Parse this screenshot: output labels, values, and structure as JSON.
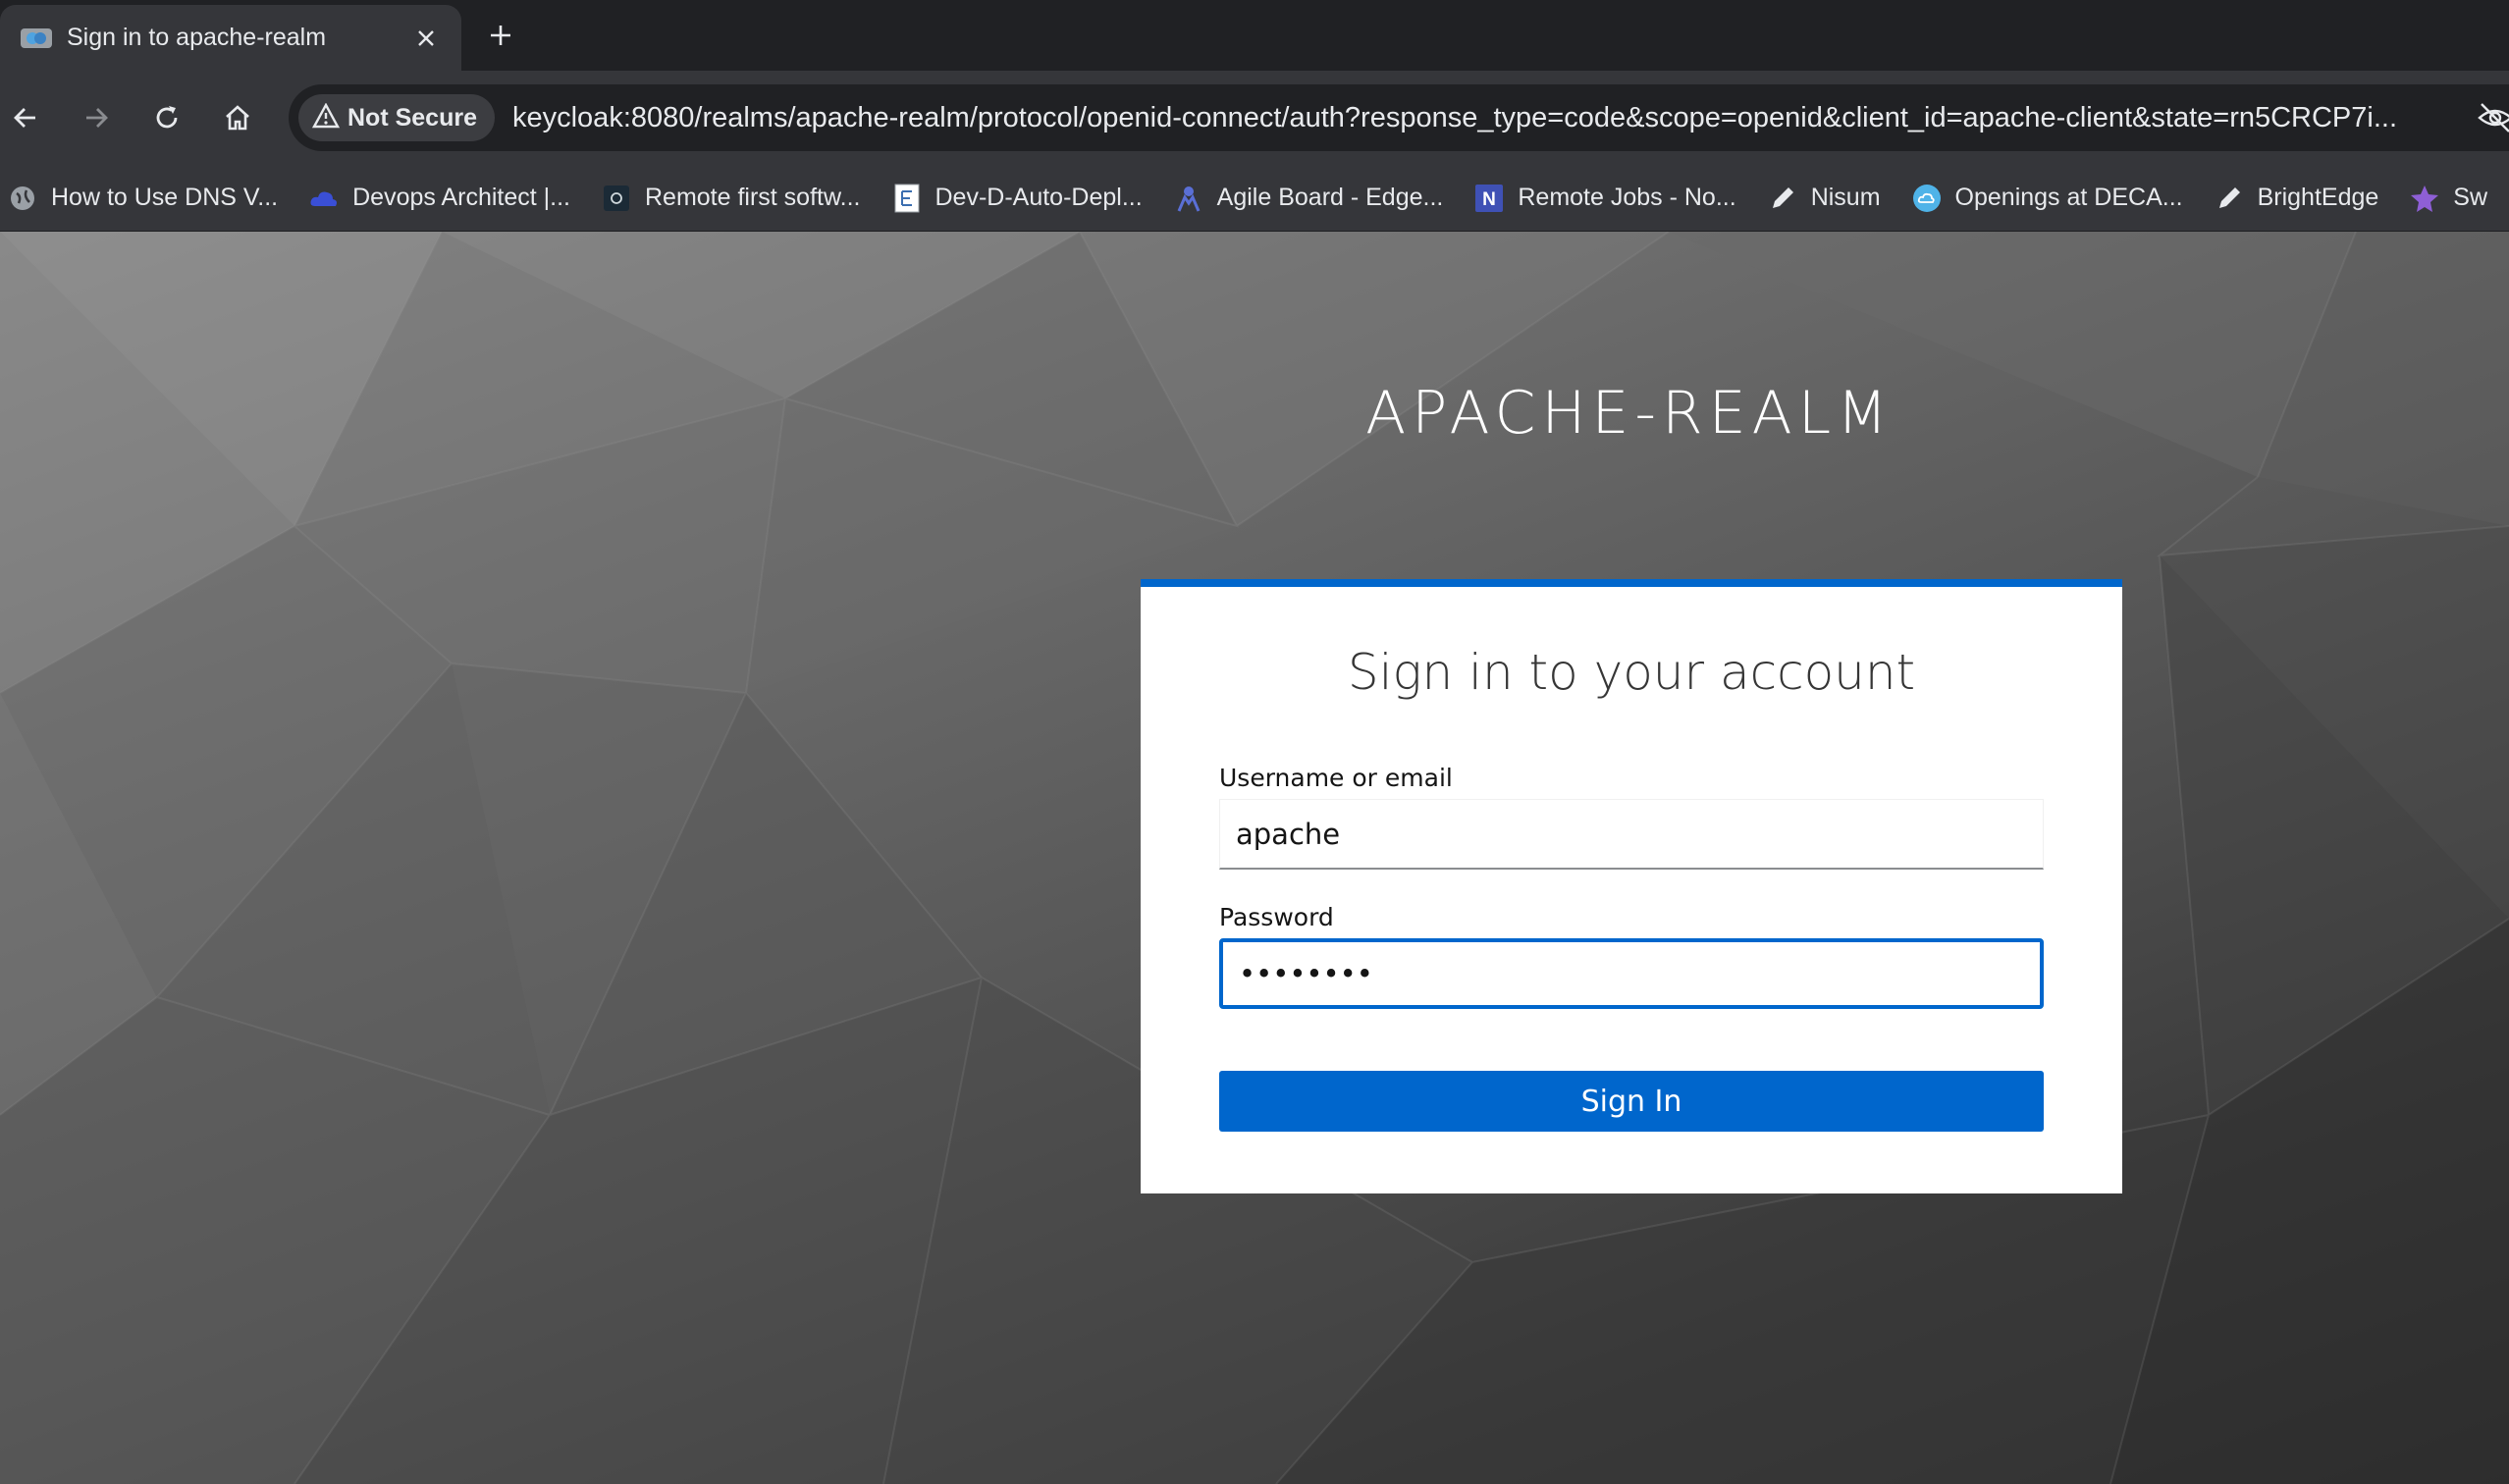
{
  "browser": {
    "tab": {
      "title": "Sign in to apache-realm",
      "favicon": "keycloak-favicon-icon"
    },
    "address_bar": {
      "security_label": "Not Secure",
      "url": "keycloak:8080/realms/apache-realm/protocol/openid-connect/auth?response_type=code&scope=openid&client_id=apache-client&state=rn5CRCP7i..."
    },
    "bookmarks": [
      {
        "label": "How to Use DNS V...",
        "icon": "globe-icon"
      },
      {
        "label": "Devops Architect |...",
        "icon": "cloud-icon"
      },
      {
        "label": "Remote first softw...",
        "icon": "dark-square-icon"
      },
      {
        "label": "Dev-D-Auto-Depl...",
        "icon": "document-icon"
      },
      {
        "label": "Agile Board - Edge...",
        "icon": "jira-icon"
      },
      {
        "label": "Remote Jobs - No...",
        "icon": "n-letter-icon"
      },
      {
        "label": "Nisum",
        "icon": "pen-icon"
      },
      {
        "label": "Openings at DECA...",
        "icon": "cloud-circle-icon"
      },
      {
        "label": "BrightEdge",
        "icon": "pen-icon"
      },
      {
        "label": "Sw",
        "icon": "star-icon"
      }
    ]
  },
  "page": {
    "realm_name": "APACHE-REALM",
    "form": {
      "title": "Sign in to your account",
      "username_label": "Username or email",
      "username_value": "apache",
      "password_label": "Password",
      "password_value": "••••••••",
      "submit_label": "Sign In"
    }
  },
  "colors": {
    "accent": "#0066cc",
    "browser_chrome": "#35363a",
    "tab_strip": "#202124"
  }
}
